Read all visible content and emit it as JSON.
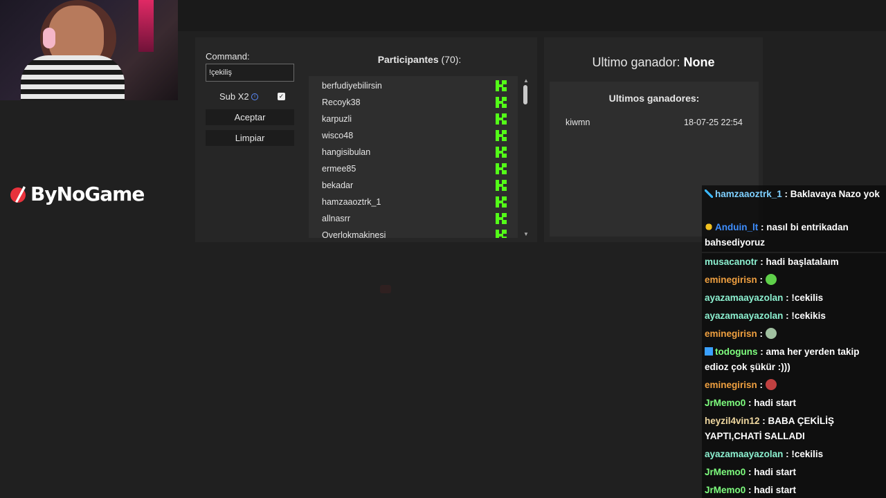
{
  "logo": {
    "text": "ByNoGame"
  },
  "command": {
    "label": "Command:",
    "value": "!çekiliş"
  },
  "sub": {
    "label": "Sub X2",
    "checked": true
  },
  "buttons": {
    "accept": "Aceptar",
    "clear": "Limpiar"
  },
  "participants": {
    "title": "Participantes",
    "count": "(70):",
    "items": [
      "berfudiyebilirsin",
      "Recoyk38",
      "karpuzli",
      "wisco48",
      "hangisibulan",
      "ermee85",
      "bekadar",
      "hamzaaoztrk_1",
      "allnasrr",
      "Overlokmakinesi"
    ]
  },
  "winner": {
    "label": "Ultimo ganador:",
    "value": "None"
  },
  "winners": {
    "title": "Ultimos ganadores:",
    "items": [
      {
        "name": "kiwmn",
        "date": "18-07-25 22:54"
      }
    ]
  },
  "chat": [
    {
      "user": "hamzaaoztrk_1",
      "color": "#7fd0ff",
      "badge": "sword",
      "text": "Baklavaya Nazo yok"
    },
    {
      "user": "Anduin_lt",
      "color": "#3e8eff",
      "badge": "gift",
      "text": "nasıl bi entrikadan bahsediyoruz"
    },
    {
      "user": "musacanotr",
      "color": "#8cf0d0",
      "badge": "",
      "text": "hadi başlatalaım"
    },
    {
      "user": "eminegirisn",
      "color": "#f0a040",
      "badge": "",
      "text": "",
      "emote": "#5fd04a"
    },
    {
      "user": "ayazamaayazolan",
      "color": "#8cf0d0",
      "badge": "",
      "text": "!cekilis"
    },
    {
      "user": "ayazamaayazolan",
      "color": "#8cf0d0",
      "badge": "",
      "text": "!cekikis"
    },
    {
      "user": "eminegirisn",
      "color": "#f0a040",
      "badge": "",
      "text": "",
      "emote": "#a0c0a0"
    },
    {
      "user": "todoguns",
      "color": "#7fff7f",
      "badge": "cube",
      "text": "ama her yerden takip edioz çok şükür :)))"
    },
    {
      "user": "eminegirisn",
      "color": "#f0a040",
      "badge": "",
      "text": "",
      "emote": "#c04040"
    },
    {
      "user": "JrMemo0",
      "color": "#7fff7f",
      "badge": "",
      "text": "hadi start"
    },
    {
      "user": "heyzil4vin12",
      "color": "#f0d8a0",
      "badge": "",
      "text": "BABA ÇEKİLİŞ YAPTI,CHATİ SALLADI"
    },
    {
      "user": "ayazamaayazolan",
      "color": "#8cf0d0",
      "badge": "",
      "text": "!cekilis"
    },
    {
      "user": "JrMemo0",
      "color": "#7fff7f",
      "badge": "",
      "text": "hadi start"
    },
    {
      "user": "JrMemo0",
      "color": "#7fff7f",
      "badge": "",
      "text": "hadi start"
    }
  ]
}
